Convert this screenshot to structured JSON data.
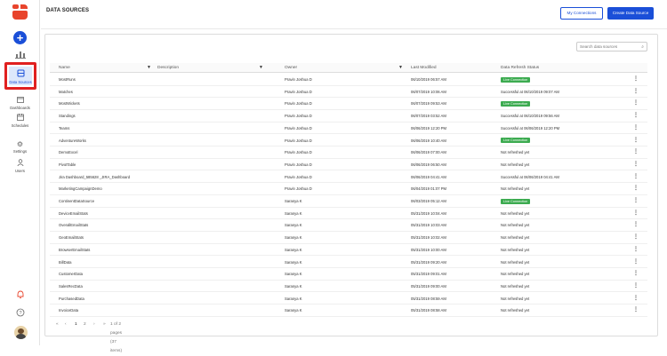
{
  "sidebar": {
    "items": [
      {
        "label": "Data Sources",
        "icon": "database-icon"
      },
      {
        "label": "Dashboards",
        "icon": "dashboard-icon"
      },
      {
        "label": "Schedules",
        "icon": "calendar-icon"
      },
      {
        "label": "Settings",
        "icon": "gear-icon"
      },
      {
        "label": "Users",
        "icon": "users-icon"
      }
    ],
    "add_label": "+"
  },
  "header": {
    "title": "DATA SOURCES",
    "my_connections": "My Connections",
    "create_data_source": "Create Data Source"
  },
  "search": {
    "placeholder": "Search data sources"
  },
  "table": {
    "columns": [
      "Name",
      "Description",
      "Owner",
      "Last Modified",
      "Data Refresh Status"
    ],
    "rows": [
      {
        "name": "MostRuns",
        "owner": "Pravin Joshua D",
        "modified": "06/10/2019 06:57 AM",
        "status": "Live Connection",
        "live": true
      },
      {
        "name": "Matches",
        "owner": "Pravin Joshua D",
        "modified": "06/07/2019 10:06 AM",
        "status": "Successful at 06/10/2019 09:07 AM",
        "live": false
      },
      {
        "name": "MostWickets",
        "owner": "Pravin Joshua D",
        "modified": "06/07/2019 09:53 AM",
        "status": "Live Connection",
        "live": true
      },
      {
        "name": "Standings",
        "owner": "Pravin Joshua D",
        "modified": "06/07/2019 03:52 AM",
        "status": "Successful at 06/10/2019 09:56 AM",
        "live": false
      },
      {
        "name": "Teams",
        "owner": "Pravin Joshua D",
        "modified": "06/06/2019 12:20 PM",
        "status": "Successful at 06/06/2019 12:20 PM",
        "live": false
      },
      {
        "name": "AdventureWorks",
        "owner": "Pravin Joshua D",
        "modified": "06/06/2019 10:40 AM",
        "status": "Live Connection",
        "live": true
      },
      {
        "name": "DemoExcel",
        "owner": "Pravin Joshua D",
        "modified": "06/06/2019 07:00 AM",
        "status": "Not refreshed yet",
        "live": false
      },
      {
        "name": "PivotTable",
        "owner": "Pravin Joshua D",
        "modified": "06/06/2019 06:50 AM",
        "status": "Not refreshed yet",
        "live": false
      },
      {
        "name": "Jira Dashboard_585628 _JIRA_Dashboard",
        "owner": "Pravin Joshua D",
        "modified": "06/06/2019 04:41 AM",
        "status": "Successful at 06/06/2019 04:41 AM",
        "live": false
      },
      {
        "name": "MarketingCampaignDemo",
        "owner": "Pravin Joshua D",
        "modified": "06/04/2019 01:07 PM",
        "status": "Not refreshed yet",
        "live": false
      },
      {
        "name": "ContinentDataSource",
        "owner": "Saranya K",
        "modified": "06/03/2019 05:12 AM",
        "status": "Live Connection",
        "live": true
      },
      {
        "name": "DeviceEmailStats",
        "owner": "Saranya K",
        "modified": "05/31/2019 10:04 AM",
        "status": "Not refreshed yet",
        "live": false
      },
      {
        "name": "OverallEmailStats",
        "owner": "Saranya K",
        "modified": "05/31/2019 10:03 AM",
        "status": "Not refreshed yet",
        "live": false
      },
      {
        "name": "GeoEmailStats",
        "owner": "Saranya K",
        "modified": "05/31/2019 10:02 AM",
        "status": "Not refreshed yet",
        "live": false
      },
      {
        "name": "BrowserEmailStats",
        "owner": "Saranya K",
        "modified": "05/31/2019 10:00 AM",
        "status": "Not refreshed yet",
        "live": false
      },
      {
        "name": "BillData",
        "owner": "Saranya K",
        "modified": "05/31/2019 09:20 AM",
        "status": "Not refreshed yet",
        "live": false
      },
      {
        "name": "CustomerData",
        "owner": "Saranya K",
        "modified": "05/31/2019 09:01 AM",
        "status": "Not refreshed yet",
        "live": false
      },
      {
        "name": "SalesRecData",
        "owner": "Saranya K",
        "modified": "05/31/2019 09:00 AM",
        "status": "Not refreshed yet",
        "live": false
      },
      {
        "name": "PurchasedData",
        "owner": "Saranya K",
        "modified": "05/31/2019 08:59 AM",
        "status": "Not refreshed yet",
        "live": false
      },
      {
        "name": "InvoiceData",
        "owner": "Saranya K",
        "modified": "05/31/2019 08:58 AM",
        "status": "Not refreshed yet",
        "live": false
      }
    ]
  },
  "pager": {
    "first": "«",
    "prev": "‹",
    "page1": "1",
    "page2": "2",
    "next": "›",
    "last": "»",
    "summary": "1 of 2 pages (37 items)"
  },
  "colors": {
    "accent": "#1a4fd8",
    "live": "#3cab50",
    "highlight": "#e02020"
  }
}
